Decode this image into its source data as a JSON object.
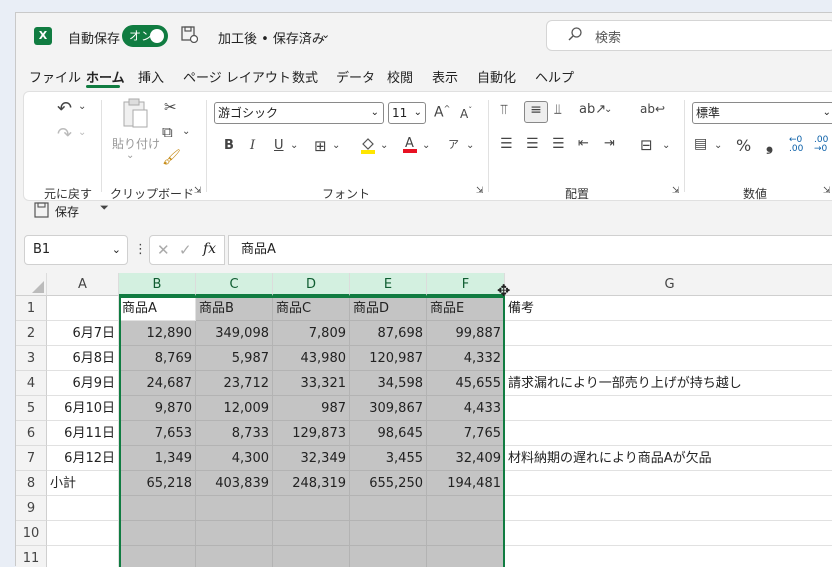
{
  "title": {
    "autosave_label": "自動保存",
    "autosave_toggle": "オン",
    "filename": "加工後 • 保存済み",
    "search_placeholder": "検索"
  },
  "menu": [
    "ファイル",
    "ホーム",
    "挿入",
    "ページ レイアウト",
    "数式",
    "データ",
    "校閲",
    "表示",
    "自動化",
    "ヘルプ"
  ],
  "ribbon": {
    "undo_group": "元に戻す",
    "clipboard_group": "クリップボード",
    "paste_label": "貼り付け",
    "font_group": "フォント",
    "font_name": "游ゴシック",
    "font_size": "11",
    "bold": "B",
    "italic": "I",
    "underline": "U",
    "align_group": "配置",
    "number_group": "数値",
    "number_format": "標準",
    "percent": "%",
    "comma": "❟"
  },
  "qat": {
    "save_label": "保存"
  },
  "formula_bar": {
    "name_box": "B1",
    "fx": "fx",
    "content": "商品A"
  },
  "columns": [
    "A",
    "B",
    "C",
    "D",
    "E",
    "F",
    "G"
  ],
  "rows": [
    [
      "",
      "商品A",
      "商品B",
      "商品C",
      "商品D",
      "商品E",
      "備考"
    ],
    [
      "6月7日",
      "12,890",
      "349,098",
      "7,809",
      "87,698",
      "99,887",
      ""
    ],
    [
      "6月8日",
      "8,769",
      "5,987",
      "43,980",
      "120,987",
      "4,332",
      ""
    ],
    [
      "6月9日",
      "24,687",
      "23,712",
      "33,321",
      "34,598",
      "45,655",
      "請求漏れにより一部売り上げが持ち越し"
    ],
    [
      "6月10日",
      "9,870",
      "12,009",
      "987",
      "309,867",
      "4,433",
      ""
    ],
    [
      "6月11日",
      "7,653",
      "8,733",
      "129,873",
      "98,645",
      "7,765",
      ""
    ],
    [
      "6月12日",
      "1,349",
      "4,300",
      "32,349",
      "3,455",
      "32,409",
      "材料納期の遅れにより商品Aが欠品"
    ],
    [
      "小計",
      "65,218",
      "403,839",
      "248,319",
      "655,250",
      "194,481",
      ""
    ],
    [
      "",
      "",
      "",
      "",
      "",
      "",
      ""
    ],
    [
      "",
      "",
      "",
      "",
      "",
      "",
      ""
    ],
    [
      "",
      "",
      "",
      "",
      "",
      "",
      ""
    ]
  ],
  "row_numbers": [
    "1",
    "2",
    "3",
    "4",
    "5",
    "6",
    "7",
    "8",
    "9",
    "10",
    "11"
  ],
  "colors": {
    "accent": "#107c41",
    "selection": "#c4c4c4",
    "header_selected": "#d3f0e0"
  }
}
